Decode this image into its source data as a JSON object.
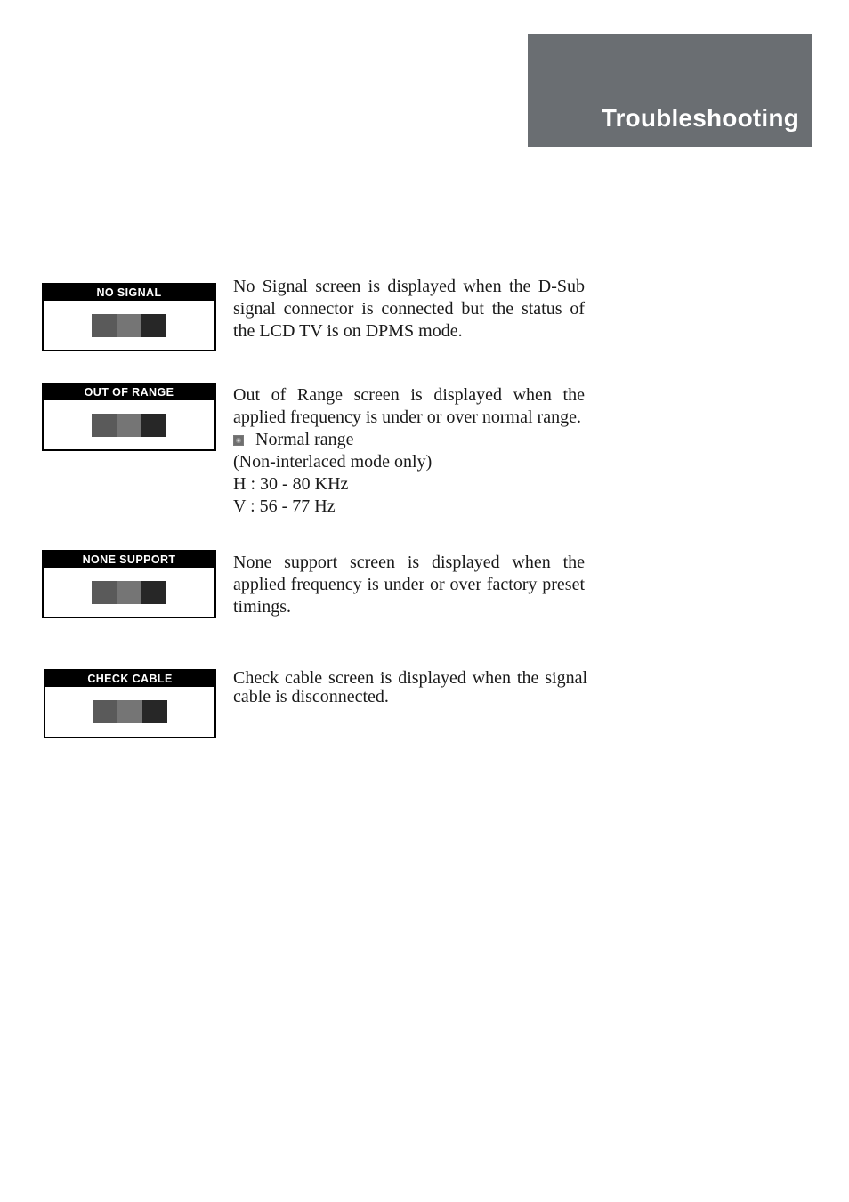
{
  "page": {
    "background_color": "#ffffff",
    "text_color": "#1a1a1a"
  },
  "banner": {
    "title": "Troubleshooting",
    "background_color": "#6a6e72",
    "text_color": "#ffffff"
  },
  "screen_colors": {
    "header_background": "#000000",
    "header_text": "#ffffff",
    "body_background": "#ffffff",
    "border": "#000000",
    "bar_left": "#5a5a5a",
    "bar_middle": "#757575",
    "bar_right": "#272727"
  },
  "sections": [
    {
      "id": "no-signal",
      "screen_label": "NO SIGNAL",
      "paragraph": "No Signal screen is displayed when the D-Sub signal connector is connected but the status of the LCD TV is on DPMS mode."
    },
    {
      "id": "out-of-range",
      "screen_label": "OUT OF RANGE",
      "paragraph": "Out of Range screen is displayed when the applied frequency is under or over normal range.",
      "bullet": {
        "icon": "small-square-bullet-icon",
        "label": "Normal range"
      },
      "details": [
        "(Non-interlaced mode only)",
        "H : 30 - 80 KHz",
        "V : 56 - 77 Hz"
      ]
    },
    {
      "id": "none-support",
      "screen_label": "NONE SUPPORT",
      "paragraph": "None support screen is displayed when the applied frequency is under or over factory preset timings."
    },
    {
      "id": "check-cable",
      "screen_label": "CHECK CABLE",
      "paragraph": "Check cable screen is displayed when the signal cable is disconnected."
    }
  ]
}
